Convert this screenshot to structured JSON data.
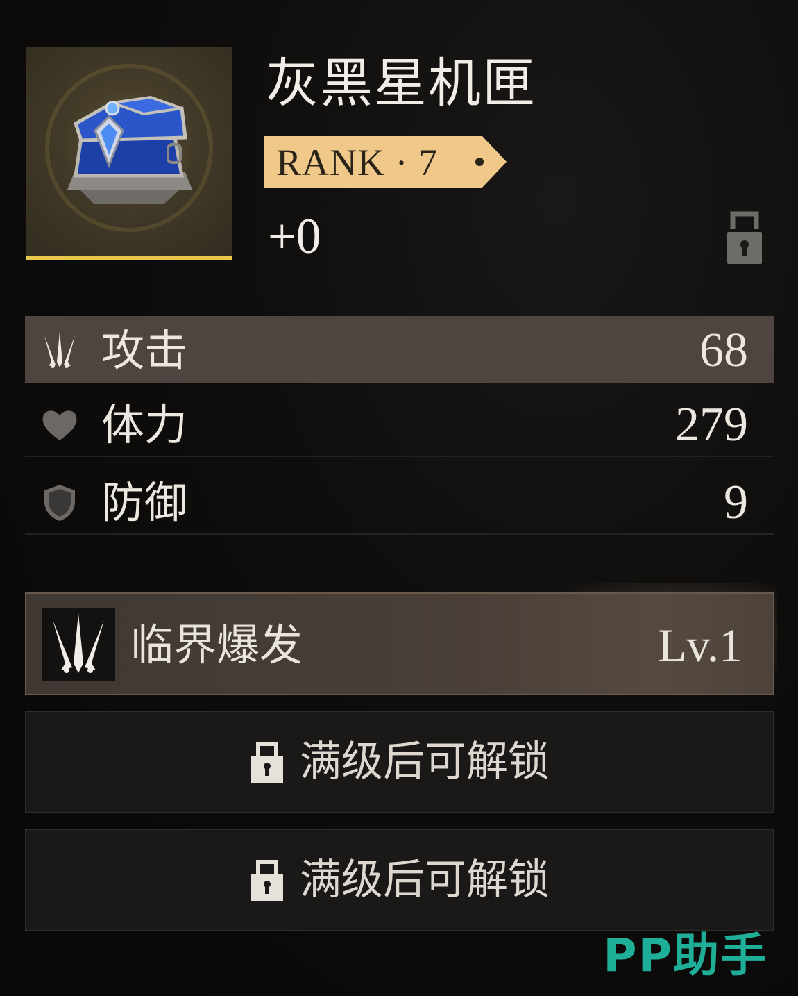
{
  "item": {
    "name": "灰黑星机匣",
    "rank_label": "RANK · 7",
    "enhance_level": "+0",
    "rarity_color": "#e8c84a",
    "icon": "blue-chest-icon",
    "lock_icon": "padlock-open-icon"
  },
  "stats": [
    {
      "icon": "claw-attack-icon",
      "label": "攻击",
      "value": "68",
      "highlighted": true
    },
    {
      "icon": "heart-icon",
      "label": "体力",
      "value": "279",
      "highlighted": false
    },
    {
      "icon": "shield-icon",
      "label": "防御",
      "value": "9",
      "highlighted": false
    }
  ],
  "skill": {
    "icon": "claw-skill-icon",
    "name": "临界爆发",
    "level": "Lv.1"
  },
  "locked_slots": [
    {
      "icon": "padlock-icon",
      "text": "满级后可解锁"
    },
    {
      "icon": "padlock-icon",
      "text": "满级后可解锁"
    }
  ],
  "watermark": "PP助手",
  "colors": {
    "rank_badge": "#f0c88a",
    "watermark": "#1fae97",
    "highlight_row": "#4e4541"
  }
}
